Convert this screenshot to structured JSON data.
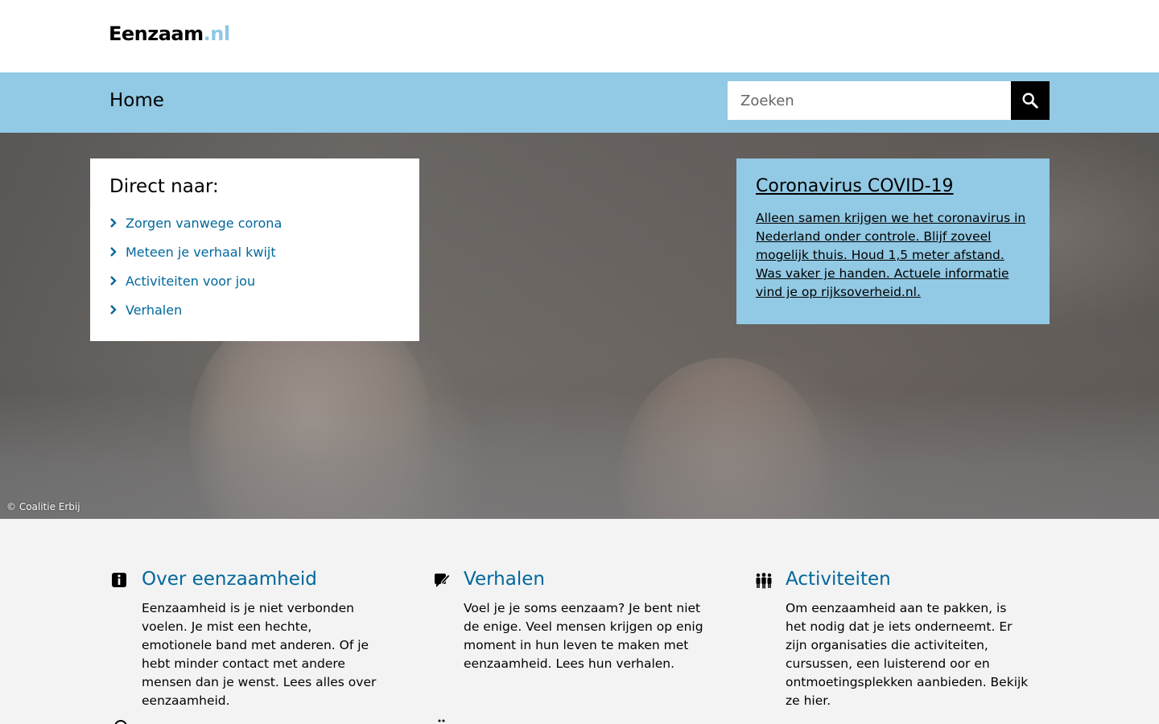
{
  "header": {
    "logo_main": "Eenzaam",
    "logo_suffix": ".nl"
  },
  "nav": {
    "title": "Home",
    "search": {
      "placeholder": "Zoeken",
      "button_icon": "search-icon"
    }
  },
  "hero": {
    "credit": "© Coalitie Erbij",
    "direct": {
      "title": "Direct naar:",
      "items": [
        {
          "label": "Zorgen vanwege corona"
        },
        {
          "label": "Meteen je verhaal kwijt"
        },
        {
          "label": "Activiteiten voor jou"
        },
        {
          "label": "Verhalen"
        }
      ]
    },
    "covid": {
      "title": "Coronavirus COVID-19",
      "text": "Alleen samen krijgen we het coronavirus in Nederland onder controle. Blijf zoveel mogelijk thuis. Houd 1,5 meter afstand. Was vaker je handen. Actuele informatie vind je op rijksoverheid.nl."
    }
  },
  "sections": [
    {
      "icon": "info-icon",
      "title": "Over eenzaamheid",
      "text": "Eenzaamheid is je niet verbonden voelen. Je mist een hechte, emotionele band met anderen. Of je hebt minder contact met andere mensen dan je wenst. Lees alles over eenzaamheid."
    },
    {
      "icon": "speech-bubble-icon",
      "title": "Verhalen",
      "text": "Voel je je soms eenzaam? Je bent niet de enige. Veel mensen krijgen op enig moment in hun leven te maken met eenzaamheid. Lees hun verhalen."
    },
    {
      "icon": "people-icon",
      "title": "Activiteiten",
      "text": "Om eenzaamheid aan te pakken, is het nodig dat je iets onderneemt. Er zijn organisaties die activiteiten, cursussen, een luisterend oor en ontmoetingsplekken aanbieden. Bekijk ze hier."
    }
  ],
  "colors": {
    "brand_blue": "#92c9e4",
    "link_blue": "#01689b",
    "content_bg": "#f3f3f3"
  }
}
